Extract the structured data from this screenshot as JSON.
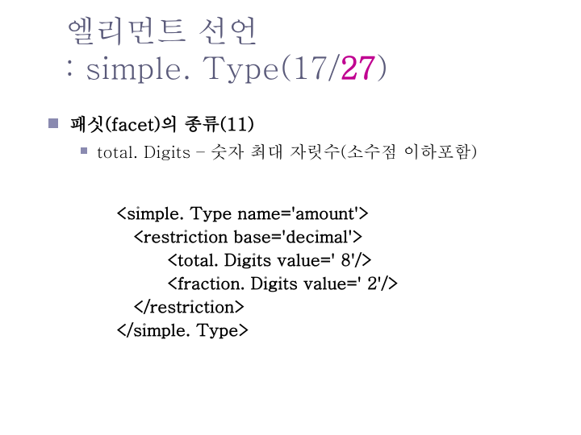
{
  "title": {
    "line1": "엘리먼트 선언",
    "colon": ": ",
    "simpleType": "simple. Type",
    "open": "(",
    "pageCurrent": "17",
    "slash": "/",
    "pageTotal": "27",
    "close": ")"
  },
  "bullets": {
    "l0": "패싯(facet)의 종류(11)",
    "l1": "total. Digits – 숫자 최대 자릿수(소수점 이하포함)"
  },
  "code": {
    "l1": "<simple. Type name='amount'>",
    "l2": "   <restriction base='decimal'>",
    "l3": "         <total. Digits value=' 8'/>",
    "l4": "         <fraction. Digits value=' 2'/>",
    "l5": "   </restriction>",
    "l6": "</simple. Type>"
  }
}
